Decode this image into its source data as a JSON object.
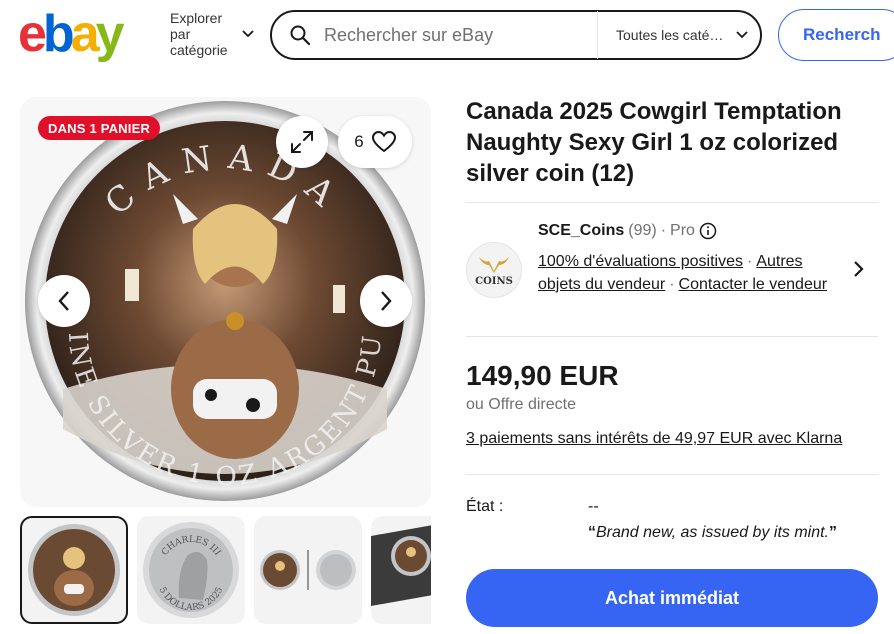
{
  "header": {
    "logo_letters": [
      {
        "char": "e",
        "color": "#e53238"
      },
      {
        "char": "b",
        "color": "#0064d2"
      },
      {
        "char": "a",
        "color": "#f5af02"
      },
      {
        "char": "y",
        "color": "#86b817"
      }
    ],
    "explore_label": "Explorer par catégorie",
    "search_placeholder": "Rechercher sur eBay",
    "category_select": "Toutes les caté…",
    "search_button": "Recherch"
  },
  "gallery": {
    "badge": "DANS 1 PANIER",
    "watch_count": "6",
    "coin_text_top": "CANADA",
    "coin_text_bottom": "FINE SILVER 1 OZ ARGENT PUR",
    "thumb2_text_top": "CHARLES III",
    "thumb2_text_bottom": "5 DOLLARS 2025"
  },
  "listing": {
    "title": "Canada 2025 Cowgirl Temptation Naughty Sexy Girl 1 oz colorized silver coin (12)",
    "seller": {
      "logo_text": "COINS",
      "name": "SCE_Coins",
      "count": "(99)",
      "pro": "Pro",
      "feedback": "100% d'évaluations positives",
      "other_items": "Autres objets du vendeur",
      "contact": "Contacter le vendeur"
    },
    "price": "149,90 EUR",
    "offer": "ou Offre directe",
    "klarna": "3 paiements sans intérêts de 49,97 EUR avec Klarna",
    "condition_label": "État :",
    "condition_value": "--",
    "condition_desc": "Brand new, as issued by its mint.",
    "buy_button": "Achat immédiat"
  },
  "colors": {
    "accent": "#3665f3",
    "badge": "#e0102b"
  }
}
